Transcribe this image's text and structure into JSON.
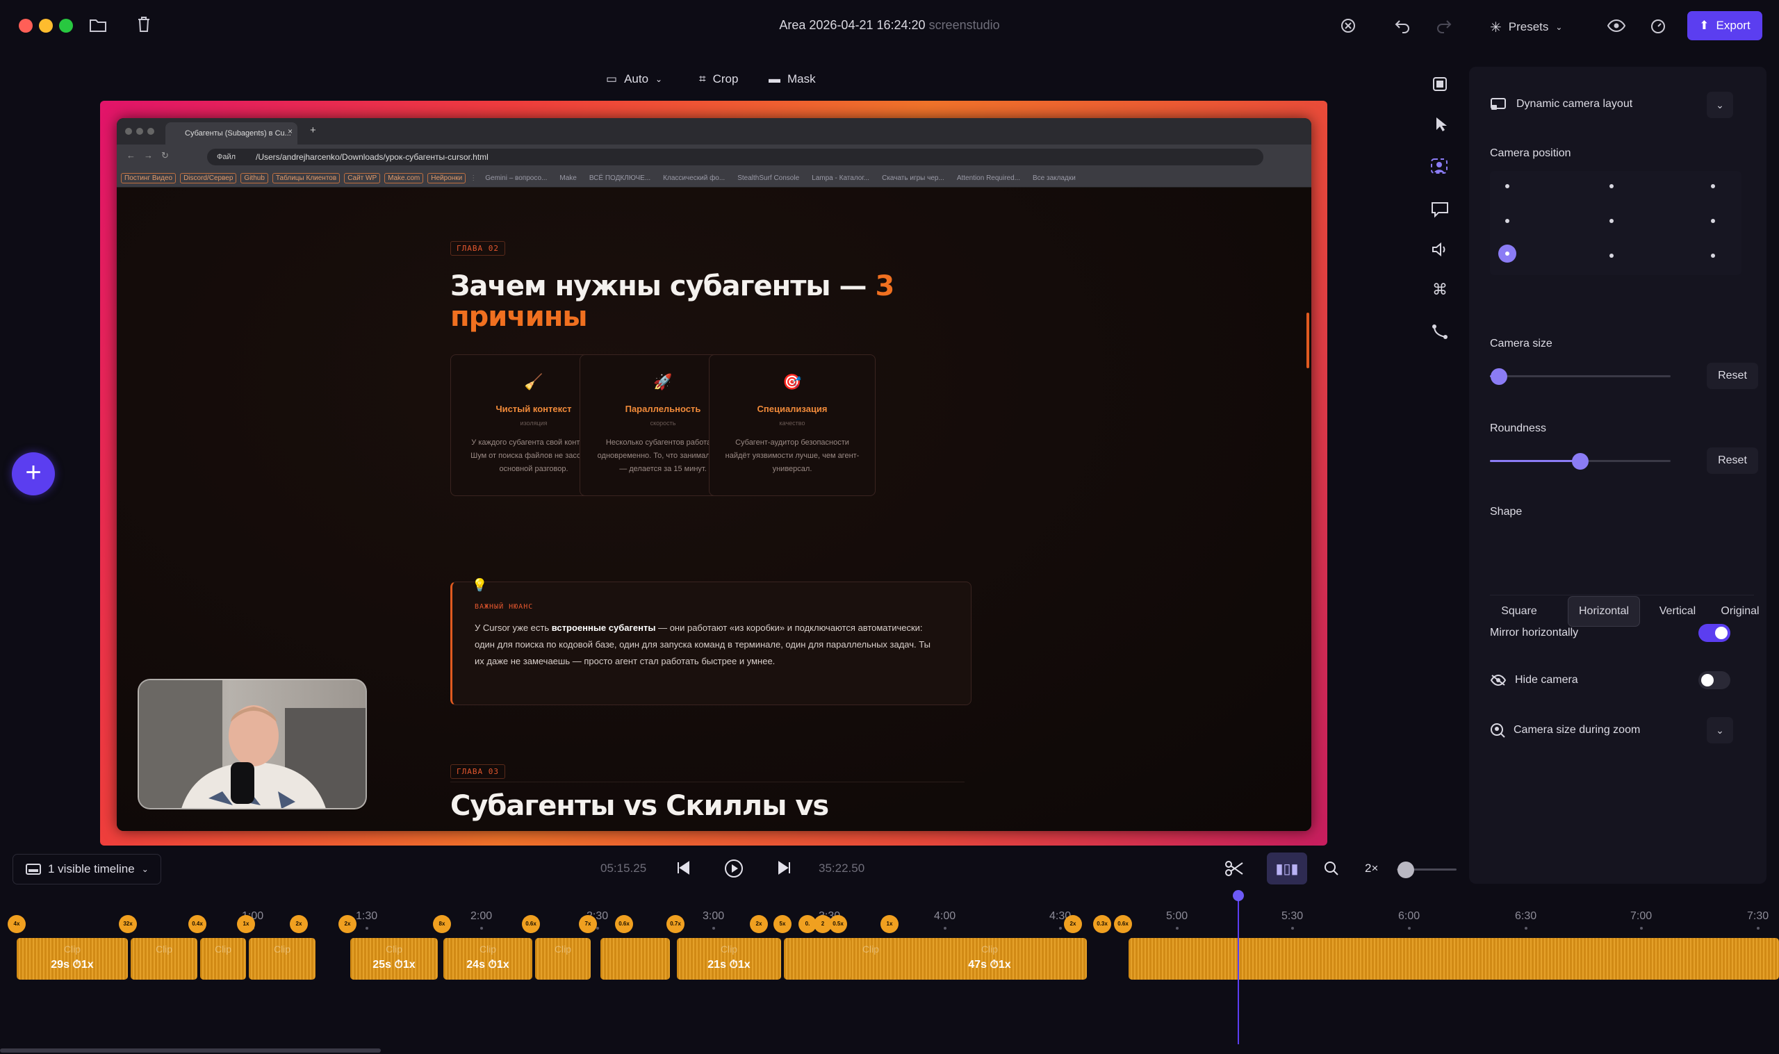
{
  "titlebar": {
    "title": "Area 2026-04-21 16:24:20",
    "app_name": "screenstudio",
    "presets": "Presets",
    "export": "Export"
  },
  "canvas_toolbar": {
    "auto": "Auto",
    "crop": "Crop",
    "mask": "Mask"
  },
  "browser": {
    "tab_title": "Субагенты (Subagents) в Cu...",
    "url_prefix": "Файл",
    "url": "/Users/andrejharcenko/Downloads/урок-субагенты-cursor.html",
    "bookmarks_tagged": [
      "Постинг Видео",
      "Discord/Сервер",
      "Github",
      "Таблицы Клиентов",
      "Сайт WP",
      "Make.com",
      "Нейронки"
    ],
    "bookmarks_plain": [
      "Gemini – вопросо...",
      "Make",
      "ВСЁ ПОДКЛЮЧЕ...",
      "Классический фо...",
      "StealthSurf Console",
      "Lampa - Каталог...",
      "Скачать игры чер...",
      "Attention Required...",
      "Все закладки"
    ]
  },
  "slide": {
    "chapter1": "ГЛАВА 02",
    "heading_main": "Зачем нужны субагенты — ",
    "heading_num": "3",
    "heading_rest": "причины",
    "cards": [
      {
        "icon": "🧹",
        "title": "Чистый контекст",
        "sub": "изоляция",
        "desc": "У каждого субагента свой контекст. Шум от поиска файлов не засоряет основной разговор."
      },
      {
        "icon": "🚀",
        "title": "Параллельность",
        "sub": "скорость",
        "desc": "Несколько субагентов работают одновременно. То, что занимало час — делается за 15 минут."
      },
      {
        "icon": "🎯",
        "title": "Специализация",
        "sub": "качество",
        "desc": "Субагент-аудитор безопасности найдёт уязвимости лучше, чем агент-универсал."
      }
    ],
    "note_icon": "💡",
    "note_title": "ВАЖНЫЙ НЮАНС",
    "note_p1": "У Cursor уже есть ",
    "note_bold": "встроенные субагенты",
    "note_p2": " — они работают «из коробки» и подключаются автоматически: один для поиска по кодовой базе, один для запуска команд в терминале, один для параллельных задач. Ты их даже не замечаешь — просто агент стал работать быстрее и умнее.",
    "chapter2": "ГЛАВА 03",
    "heading2": "Субагенты vs Скиллы vs"
  },
  "panel": {
    "layout_label": "Dynamic camera layout",
    "camera_position": "Camera position",
    "camera_position_selected": "bottom-left",
    "camera_size": "Camera size",
    "camera_size_value": 0.05,
    "reset": "Reset",
    "roundness": "Roundness",
    "roundness_value": 0.5,
    "shape": "Shape",
    "shapes": [
      "Square",
      "Horizontal",
      "Vertical",
      "Original"
    ],
    "shape_selected": "Horizontal",
    "mirror": "Mirror horizontally",
    "mirror_on": true,
    "hide_camera": "Hide camera",
    "hide_camera_on": false,
    "size_during_zoom": "Camera size during zoom"
  },
  "playback": {
    "timeline_select": "1 visible timeline",
    "current_time": "05:15.25",
    "total_time": "35:22.50",
    "zoom": "2×"
  },
  "ruler_labels": [
    "1:00",
    "1:30",
    "2:00",
    "2:30",
    "3:00",
    "3:30",
    "4:00",
    "4:30",
    "5:00",
    "5:30",
    "6:00",
    "6:30",
    "7:00",
    "7:30"
  ],
  "markers": [
    "4x",
    "32x",
    "0.4x",
    "1x",
    "2x",
    "2x",
    "8x",
    "0.6x",
    "7x",
    "0.6x",
    "0.7x",
    "2x",
    "5x",
    "0.",
    "2",
    "0.5x",
    "1x",
    "2x",
    "0.3x",
    "0.6x"
  ],
  "clips": [
    {
      "label": "Clip",
      "info": "29s ⏱1x"
    },
    {
      "label": "Clip",
      "info": ""
    },
    {
      "label": "Clip",
      "info": ""
    },
    {
      "label": "Clip",
      "info": ""
    },
    {
      "label": "Clip",
      "info": "25s ⏱1x"
    },
    {
      "label": "Clip",
      "info": "24s ⏱1x"
    },
    {
      "label": "Clip",
      "info": ""
    },
    {
      "label": "Clip",
      "info": "21s ⏱1x"
    },
    {
      "label": "Clip",
      "info": ""
    },
    {
      "label": "Clip",
      "info": "47s ⏱1x"
    }
  ],
  "colors": {
    "accent": "#5b3ef0",
    "slide_accent": "#f07020",
    "clip": "#d18a15"
  }
}
